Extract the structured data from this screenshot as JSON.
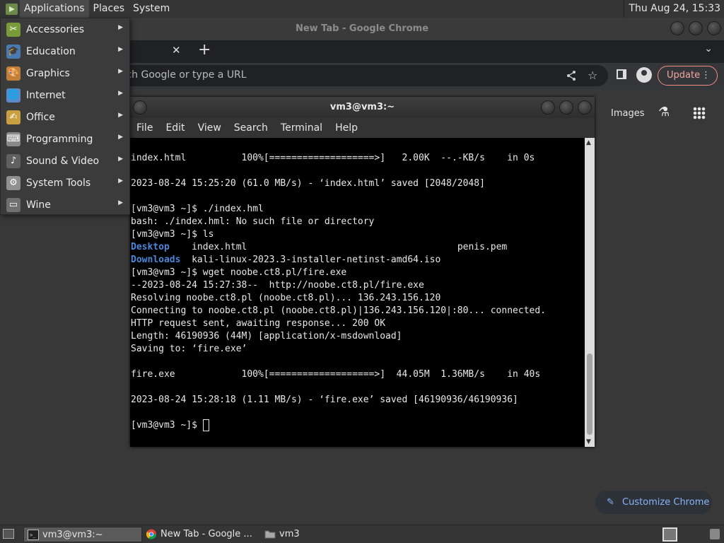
{
  "top_panel": {
    "menus": [
      "Applications",
      "Places",
      "System"
    ],
    "clock": "Thu Aug 24, 15:33"
  },
  "applications_menu": {
    "items": [
      {
        "label": "Accessories",
        "icon": "accessories-icon",
        "color": "#7a9b3a"
      },
      {
        "label": "Education",
        "icon": "education-icon",
        "color": "#4a7ab0"
      },
      {
        "label": "Graphics",
        "icon": "graphics-icon",
        "color": "#c0803a"
      },
      {
        "label": "Internet",
        "icon": "internet-icon",
        "color": "#5a8ac8"
      },
      {
        "label": "Office",
        "icon": "office-icon",
        "color": "#c8a040"
      },
      {
        "label": "Programming",
        "icon": "programming-icon",
        "color": "#8a8a8a"
      },
      {
        "label": "Sound & Video",
        "icon": "sound-video-icon",
        "color": "#606060"
      },
      {
        "label": "System Tools",
        "icon": "system-tools-icon",
        "color": "#909090"
      },
      {
        "label": "Wine",
        "icon": "wine-icon",
        "color": "#707070"
      }
    ]
  },
  "chrome": {
    "window_title": "New Tab - Google Chrome",
    "omnibox_placeholder": "rch Google or type a URL",
    "update_label": "Update",
    "ntp_images_label": "Images",
    "customize_label": "Customize Chrome"
  },
  "terminal": {
    "title": "vm3@vm3:~",
    "menus": [
      "File",
      "Edit",
      "View",
      "Search",
      "Terminal",
      "Help"
    ],
    "lines": [
      "index.html          100%[===================>]   2.00K  --.-KB/s    in 0s",
      "",
      "2023-08-24 15:25:20 (61.0 MB/s) - ‘index.html’ saved [2048/2048]",
      "",
      "[vm3@vm3 ~]$ ./index.hml",
      "bash: ./index.hml: No such file or directory",
      "[vm3@vm3 ~]$ ls",
      "",
      "",
      "[vm3@vm3 ~]$ wget noobe.ct8.pl/fire.exe",
      "--2023-08-24 15:27:38--  http://noobe.ct8.pl/fire.exe",
      "Resolving noobe.ct8.pl (noobe.ct8.pl)... 136.243.156.120",
      "Connecting to noobe.ct8.pl (noobe.ct8.pl)|136.243.156.120|:80... connected.",
      "HTTP request sent, awaiting response... 200 OK",
      "Length: 46190936 (44M) [application/x-msdownload]",
      "Saving to: ‘fire.exe’",
      "",
      "fire.exe            100%[===================>]  44.05M  1.36MB/s    in 40s",
      "",
      "2023-08-24 15:28:18 (1.11 MB/s) - ‘fire.exe’ saved [46190936/46190936]",
      "",
      "[vm3@vm3 ~]$ "
    ],
    "ls_row1": {
      "dir": "Desktop",
      "gap1": "    ",
      "file": "index.html",
      "gap2": "                                      ",
      "file2": "penis.pem"
    },
    "ls_row2": {
      "dir": "Downloads",
      "gap1": "  ",
      "file": "kali-linux-2023.3-installer-netinst-amd64.iso"
    },
    "colors": {
      "dir": "#4a86d8",
      "text": "#e8e8e8",
      "background": "#000000"
    }
  },
  "taskbar": {
    "tasks": [
      {
        "label": "vm3@vm3:~",
        "icon": "terminal-icon",
        "active": true
      },
      {
        "label": "New Tab - Google ...",
        "icon": "chrome-icon",
        "active": false
      },
      {
        "label": "vm3",
        "icon": "folder-icon",
        "active": false
      }
    ]
  }
}
